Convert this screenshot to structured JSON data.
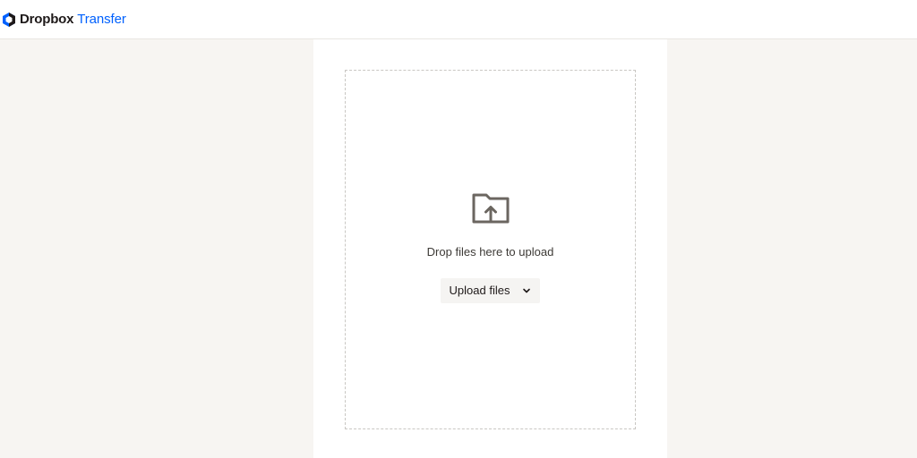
{
  "header": {
    "brand_name": "Dropbox",
    "product_name": "Transfer",
    "logo_icon": "dropbox-logo-icon"
  },
  "dropzone": {
    "icon": "folder-upload-icon",
    "message": "Drop files here to upload",
    "upload_button_label": "Upload files",
    "upload_button_icon": "chevron-down-icon"
  },
  "colors": {
    "brand_blue": "#0061fe",
    "page_background": "#f7f5f2",
    "panel_background": "#ffffff",
    "icon_gray": "#6b6660"
  }
}
